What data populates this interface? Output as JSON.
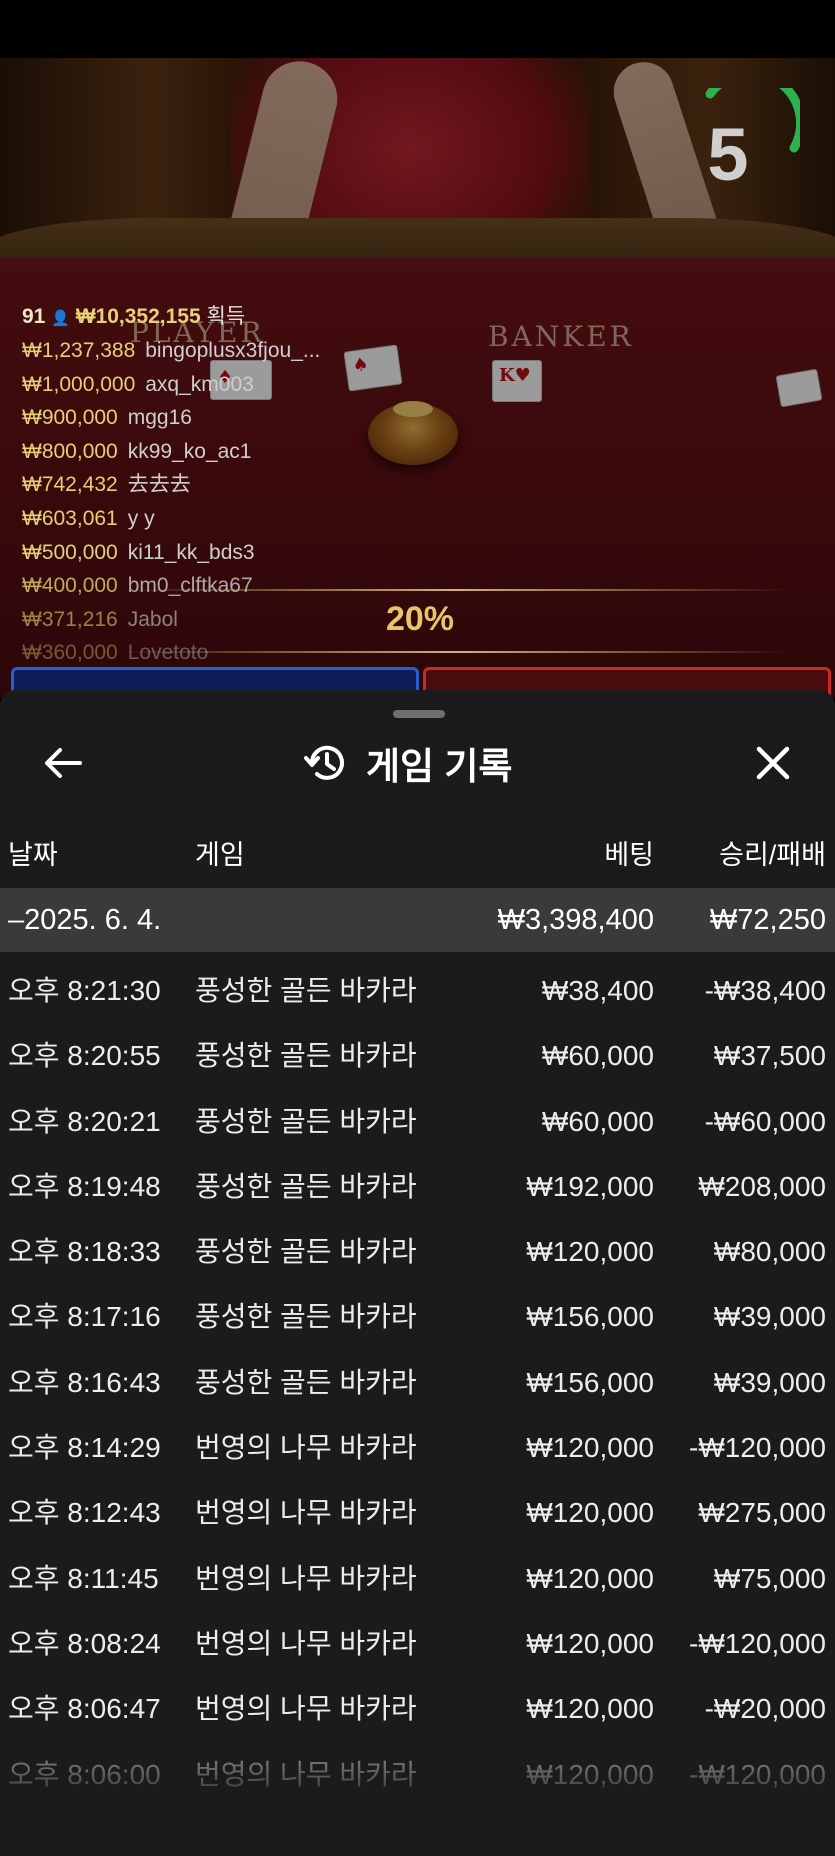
{
  "countdown": "5",
  "leaderboard": {
    "player_count": "91",
    "total_amount": "₩10,352,155",
    "total_label": "획득",
    "entries": [
      {
        "amount": "₩1,237,388",
        "name": "bingoplusx3fjou_..."
      },
      {
        "amount": "₩1,000,000",
        "name": "axq_km003"
      },
      {
        "amount": "₩900,000",
        "name": "mgg16"
      },
      {
        "amount": "₩800,000",
        "name": "kk99_ko_ac1"
      },
      {
        "amount": "₩742,432",
        "name": "去去去"
      },
      {
        "amount": "₩603,061",
        "name": "y y"
      },
      {
        "amount": "₩500,000",
        "name": "ki11_kk_bds3"
      },
      {
        "amount": "₩400,000",
        "name": "bm0_clftka67"
      },
      {
        "amount": "₩371,216",
        "name": "Jabol"
      },
      {
        "amount": "₩360,000",
        "name": "Lovetoto"
      }
    ]
  },
  "table_labels": {
    "player": "PLAYER",
    "banker": "BANKER"
  },
  "percent_badge": "20%",
  "panel": {
    "title": "게임 기록",
    "icons": {
      "back": "arrow-left-icon",
      "history": "history-icon",
      "close": "close-icon"
    },
    "columns": {
      "date": "날짜",
      "game": "게임",
      "bet": "베팅",
      "result": "승리/패배"
    },
    "date_group": {
      "date": "–2025. 6. 4.",
      "bet_total": "₩3,398,400",
      "result_total": "₩72,250"
    },
    "rows": [
      {
        "time": "오후 8:21:30",
        "game": "풍성한 골든 바카라",
        "bet": "₩38,400",
        "result": "-₩38,400"
      },
      {
        "time": "오후 8:20:55",
        "game": "풍성한 골든 바카라",
        "bet": "₩60,000",
        "result": "₩37,500"
      },
      {
        "time": "오후 8:20:21",
        "game": "풍성한 골든 바카라",
        "bet": "₩60,000",
        "result": "-₩60,000"
      },
      {
        "time": "오후 8:19:48",
        "game": "풍성한 골든 바카라",
        "bet": "₩192,000",
        "result": "₩208,000"
      },
      {
        "time": "오후 8:18:33",
        "game": "풍성한 골든 바카라",
        "bet": "₩120,000",
        "result": "₩80,000"
      },
      {
        "time": "오후 8:17:16",
        "game": "풍성한 골든 바카라",
        "bet": "₩156,000",
        "result": "₩39,000"
      },
      {
        "time": "오후 8:16:43",
        "game": "풍성한 골든 바카라",
        "bet": "₩156,000",
        "result": "₩39,000"
      },
      {
        "time": "오후 8:14:29",
        "game": "번영의 나무 바카라",
        "bet": "₩120,000",
        "result": "-₩120,000"
      },
      {
        "time": "오후 8:12:43",
        "game": "번영의 나무 바카라",
        "bet": "₩120,000",
        "result": "₩275,000"
      },
      {
        "time": "오후 8:11:45",
        "game": "번영의 나무 바카라",
        "bet": "₩120,000",
        "result": "₩75,000"
      },
      {
        "time": "오후 8:08:24",
        "game": "번영의 나무 바카라",
        "bet": "₩120,000",
        "result": "-₩120,000"
      },
      {
        "time": "오후 8:06:47",
        "game": "번영의 나무 바카라",
        "bet": "₩120,000",
        "result": "-₩20,000"
      },
      {
        "time": "오후 8:06:00",
        "game": "번영의 나무 바카라",
        "bet": "₩120,000",
        "result": "-₩120,000"
      }
    ]
  },
  "colors": {
    "panel_bg": "#1b1b1b",
    "date_row_bg": "#3a3a3a",
    "timer_arc": "#2bb24c",
    "gold": "#e6cf74"
  }
}
